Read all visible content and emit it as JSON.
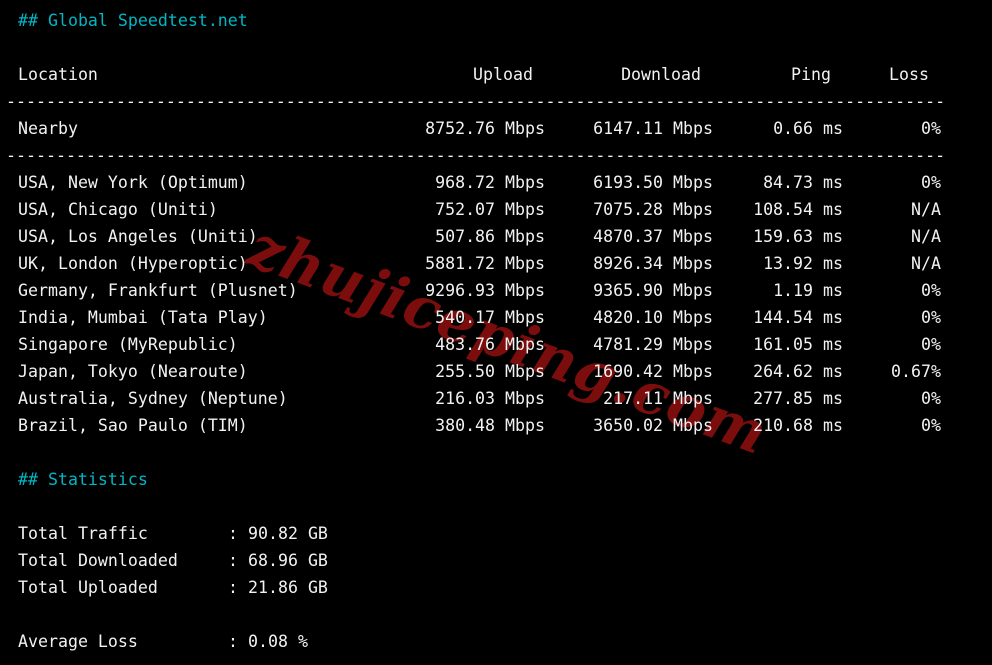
{
  "terminal": {
    "title": "## Global Speedtest.net",
    "stats_title": "## Statistics",
    "colon": ":",
    "watermark": "zhujiceping.com",
    "colors": {
      "background": "#000000",
      "text": "#f2f2f2",
      "heading_cyan": "#00b6c4",
      "watermark_red": "#7c0d0d"
    },
    "table": {
      "headers": [
        "Location",
        "Upload",
        "Download",
        "Ping",
        "Loss"
      ],
      "separator": "----------------------------------------------------------------------------------------------",
      "nearby": {
        "location": "Nearby",
        "upload": "8752.76 Mbps",
        "download": "6147.11 Mbps",
        "ping": "0.66 ms",
        "loss": "0%"
      },
      "rows": [
        {
          "location": "USA, New York (Optimum)",
          "upload": "968.72 Mbps",
          "download": "6193.50 Mbps",
          "ping": "84.73 ms",
          "loss": "0%"
        },
        {
          "location": "USA, Chicago (Uniti)",
          "upload": "752.07 Mbps",
          "download": "7075.28 Mbps",
          "ping": "108.54 ms",
          "loss": "N/A"
        },
        {
          "location": "USA, Los Angeles (Uniti)",
          "upload": "507.86 Mbps",
          "download": "4870.37 Mbps",
          "ping": "159.63 ms",
          "loss": "N/A"
        },
        {
          "location": "UK, London (Hyperoptic)",
          "upload": "5881.72 Mbps",
          "download": "8926.34 Mbps",
          "ping": "13.92 ms",
          "loss": "N/A"
        },
        {
          "location": "Germany, Frankfurt (Plusnet)",
          "upload": "9296.93 Mbps",
          "download": "9365.90 Mbps",
          "ping": "1.19 ms",
          "loss": "0%"
        },
        {
          "location": "India, Mumbai (Tata Play)",
          "upload": "540.17 Mbps",
          "download": "4820.10 Mbps",
          "ping": "144.54 ms",
          "loss": "0%"
        },
        {
          "location": "Singapore (MyRepublic)",
          "upload": "483.76 Mbps",
          "download": "4781.29 Mbps",
          "ping": "161.05 ms",
          "loss": "0%"
        },
        {
          "location": "Japan, Tokyo (Nearoute)",
          "upload": "255.50 Mbps",
          "download": "1690.42 Mbps",
          "ping": "264.62 ms",
          "loss": "0.67%"
        },
        {
          "location": "Australia, Sydney (Neptune)",
          "upload": "216.03 Mbps",
          "download": "217.11 Mbps",
          "ping": "277.85 ms",
          "loss": "0%"
        },
        {
          "location": "Brazil, Sao Paulo (TIM)",
          "upload": "380.48 Mbps",
          "download": "3650.02 Mbps",
          "ping": "210.68 ms",
          "loss": "0%"
        }
      ]
    },
    "stats": [
      {
        "label": "Total Traffic",
        "value": "90.82 GB"
      },
      {
        "label": "Total Downloaded",
        "value": "68.96 GB"
      },
      {
        "label": "Total Uploaded",
        "value": "21.86 GB"
      }
    ],
    "average": {
      "label": "Average Loss",
      "value": "0.08 %"
    }
  }
}
